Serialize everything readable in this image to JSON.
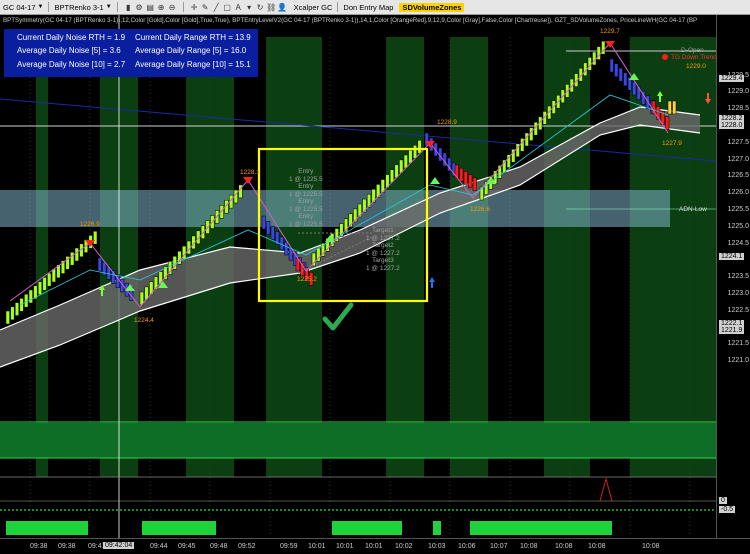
{
  "toolbar": {
    "instrument": "GC 04-17",
    "chart_type": "BPTRenko 3-1",
    "account": "Xcalper GC",
    "workspace": "Don Entry Map",
    "indicator_tab": "SDVolumeZones"
  },
  "indicator_header": "BPTSymmetry(GC 04-17 (BPTRenko 3-1)),12,Color [Gold],Color [Gold],True,True), BPTEntryLevelV2(GC 04-17 (BPTRenko 3-1)),14,1,Color [OrangeRed],9,12,9,Color [Gray],False,Color [Chartreuse]), GZT_SDVolumeZones, PriceLineWH(GC 04-17 (BP",
  "stats": {
    "noise_rth": "Current Daily Noise RTH = 1.9",
    "noise_5": "Average Daily Noise [5] = 3.6",
    "noise_10": "Average Daily Noise [10] = 2.7",
    "range_rth": "Current Daily Range RTH = 13.9",
    "range_5": "Average Daily Range [5] = 16.0",
    "range_10": "Average Daily Range [10] = 15.1"
  },
  "annotations": {
    "hi_1226_9": "1226.9",
    "lo_1224_4": "1224.4",
    "hi_1228_1": "1228.1",
    "lo_1225_2": "1225.2",
    "hi_1228_9": "1228.9",
    "lo_1226_6": "1226.6",
    "hi_1229_7": "1229.7",
    "val_1229_0": "1229.0",
    "lo_1227_9": "1227.9",
    "d_open": "D-Open",
    "tg_down": "TG Down Trend",
    "adn_low": "ADN-Low",
    "entries": [
      "Entry",
      "1 @ 1225.5",
      "Entry",
      "1 @ 1225.5",
      "Entry",
      "1 @ 1225.5",
      "Entry",
      "1 @ 1225.5"
    ],
    "targets": [
      "Target1",
      "1 @ 1227.2",
      "Target2",
      "1 @ 1227.2",
      "Target3",
      "1 @ 1227.2"
    ]
  },
  "price_labels": [
    "1229.5",
    "1229.0",
    "1228.5",
    "1227.5",
    "1227.0",
    "1226.5",
    "1226.0",
    "1225.5",
    "1225.0",
    "1224.5",
    "1223.5",
    "1223.0",
    "1222.5",
    "1221.5",
    "1221.0"
  ],
  "price_boxes": [
    "1229.4",
    "1228.2",
    "1228.0",
    "1224.1",
    "1222.1",
    "1221.9"
  ],
  "osc_labels": [
    "0",
    "-0.5"
  ],
  "time_labels": [
    "09:38",
    "09:38",
    "09:41",
    "09:44",
    "09:45",
    "09:48",
    "09:52",
    "09:59",
    "10:01",
    "10:01",
    "10:01",
    "10:02",
    "10:03",
    "10:06",
    "10:07",
    "10:08",
    "10:08",
    "10:08",
    "10:08"
  ],
  "time_box": "09:42:04",
  "colors": {
    "bull_bar": "#a8ff1a",
    "bull_dark": "#3e8f00",
    "bear_bar": "#3c46e0",
    "bear_red": "#ff1a1a",
    "stats_bg": "#0a1fa0",
    "zone": "#7fb3c8",
    "green_zone": "#0f6e26",
    "annotation_orange": "#ff9900",
    "check_green": "#2fa84f"
  }
}
